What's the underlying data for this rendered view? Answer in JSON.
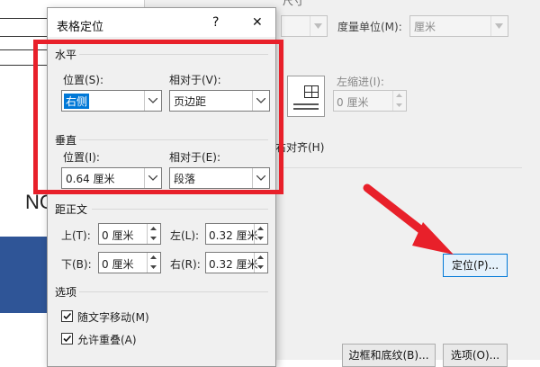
{
  "dialog": {
    "title": "表格定位",
    "help_glyph": "?",
    "close_glyph": "✕",
    "horizontal": {
      "group_label": "水平",
      "position_label": "位置(S):",
      "position_value": "右侧",
      "relative_label": "相对于(V):",
      "relative_value": "页边距"
    },
    "vertical": {
      "group_label": "垂直",
      "position_label": "位置(I):",
      "position_value": "0.64 厘米",
      "relative_label": "相对于(E):",
      "relative_value": "段落"
    },
    "distance": {
      "group_label": "距正文",
      "top_label": "上(T):",
      "top_value": "0 厘米",
      "bottom_label": "下(B):",
      "bottom_value": "0 厘米",
      "left_label": "左(L):",
      "left_value": "0.32 厘米",
      "right_label": "右(R):",
      "right_value": "0.32 厘米"
    },
    "options": {
      "group_label": "选项",
      "move_with_text": "随文字移动(M)",
      "allow_overlap": "允许重叠(A)"
    }
  },
  "background_dialog": {
    "top_fragment": "尺寸",
    "unit_label": "度量单位(M):",
    "unit_value": "厘米",
    "indent_label": "左缩进(I):",
    "indent_value": "0 厘米",
    "align_right_label": "右对齐(H)",
    "position_button": "定位(P)...",
    "borders_button": "边框和底纹(B)...",
    "options_button": "选项(O)..."
  },
  "document": {
    "text_fragment": "NC"
  },
  "colors": {
    "highlight_red": "#e8202a",
    "arrow_red": "#e8202a",
    "doc_blue_block": "#2f5597",
    "focus_blue": "#0078d7"
  }
}
